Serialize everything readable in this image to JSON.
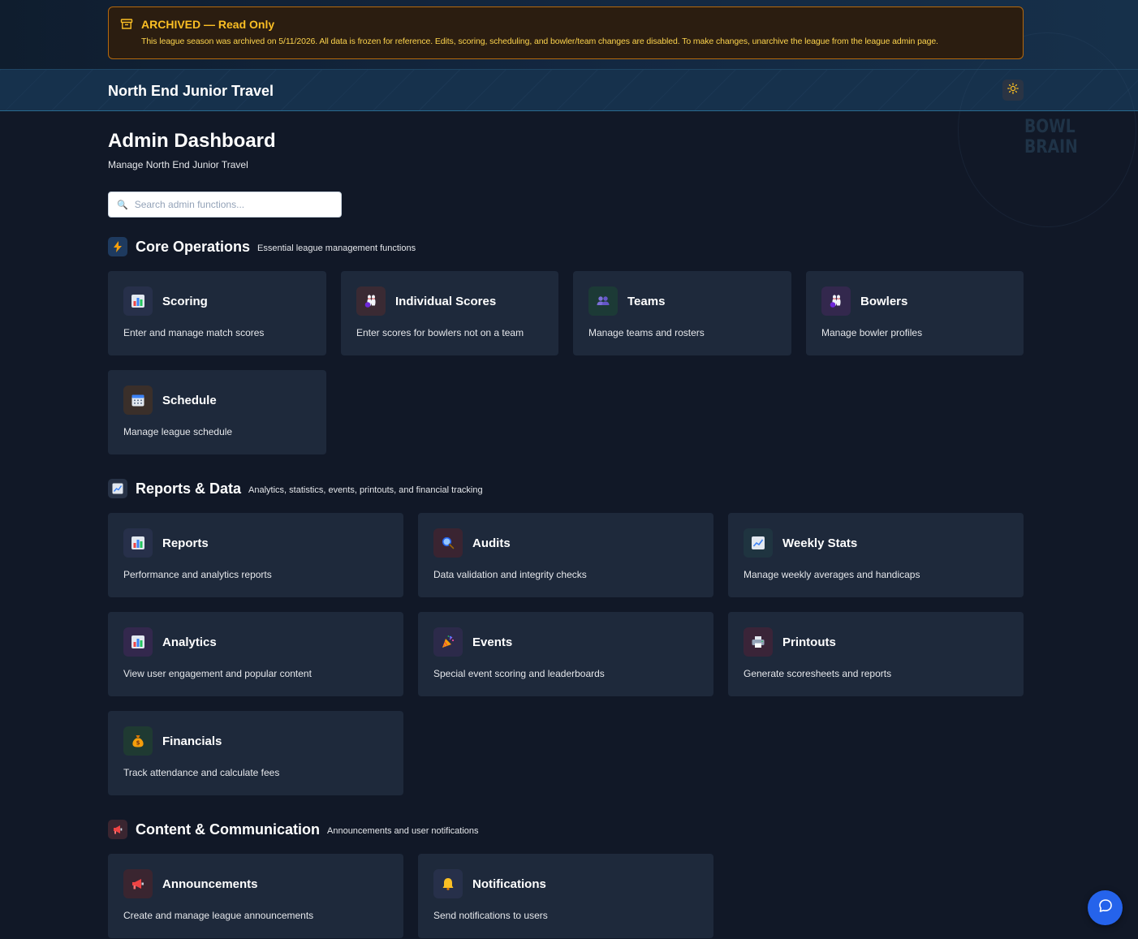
{
  "banner": {
    "title": "ARCHIVED — Read Only",
    "message": "This league season was archived on 5/11/2026. All data is frozen for reference. Edits, scoring, scheduling, and bowler/team changes are disabled. To make changes, unarchive the league from the league admin page.",
    "icon": "archive-box-icon"
  },
  "header": {
    "league_name": "North End Junior Travel",
    "theme_icon": "sun-icon",
    "watermark": "BOWL BRAIN"
  },
  "page": {
    "title": "Admin Dashboard",
    "subtitle": "Manage North End Junior Travel"
  },
  "search": {
    "placeholder": "Search admin functions...",
    "value": ""
  },
  "sections": {
    "core": {
      "title": "Core Operations",
      "description": "Essential league management functions",
      "icon": "lightning-icon",
      "cards": [
        {
          "title": "Scoring",
          "description": "Enter and manage match scores",
          "icon": "bar-chart-icon"
        },
        {
          "title": "Individual Scores",
          "description": "Enter scores for bowlers not on a team",
          "icon": "bowling-icon"
        },
        {
          "title": "Teams",
          "description": "Manage teams and rosters",
          "icon": "people-icon"
        },
        {
          "title": "Bowlers",
          "description": "Manage bowler profiles",
          "icon": "bowling-icon"
        },
        {
          "title": "Schedule",
          "description": "Manage league schedule",
          "icon": "calendar-icon"
        }
      ]
    },
    "reports": {
      "title": "Reports & Data",
      "description": "Analytics, statistics, events, printouts, and financial tracking",
      "icon": "trend-chart-icon",
      "cards": [
        {
          "title": "Reports",
          "description": "Performance and analytics reports",
          "icon": "bar-chart-icon"
        },
        {
          "title": "Audits",
          "description": "Data validation and integrity checks",
          "icon": "magnifier-icon"
        },
        {
          "title": "Weekly Stats",
          "description": "Manage weekly averages and handicaps",
          "icon": "trend-chart-icon"
        },
        {
          "title": "Analytics",
          "description": "View user engagement and popular content",
          "icon": "bar-chart-icon"
        },
        {
          "title": "Events",
          "description": "Special event scoring and leaderboards",
          "icon": "party-popper-icon"
        },
        {
          "title": "Printouts",
          "description": "Generate scoresheets and reports",
          "icon": "printer-icon"
        },
        {
          "title": "Financials",
          "description": "Track attendance and calculate fees",
          "icon": "money-bag-icon"
        }
      ]
    },
    "content": {
      "title": "Content & Communication",
      "description": "Announcements and user notifications",
      "icon": "megaphone-icon",
      "cards": [
        {
          "title": "Announcements",
          "description": "Create and manage league announcements",
          "icon": "megaphone-icon"
        },
        {
          "title": "Notifications",
          "description": "Send notifications to users",
          "icon": "bell-icon"
        }
      ]
    }
  },
  "chat": {
    "icon": "chat-bubble-icon"
  },
  "colors": {
    "background": "#111827",
    "card": "#1e293b",
    "banner_border": "#b4690e",
    "banner_text": "#fbbf24",
    "accent_blue": "#2563eb"
  }
}
